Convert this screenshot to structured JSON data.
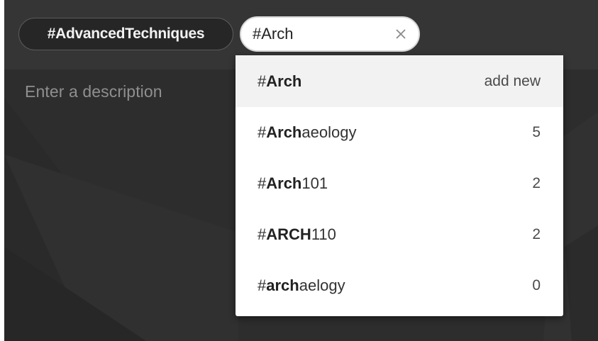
{
  "tags": {
    "existing_chip": "#AdvancedTechniques",
    "input_value": "#Arch"
  },
  "description": {
    "placeholder": "Enter a description"
  },
  "suggestions": [
    {
      "hash": "#",
      "match": "Arch",
      "rest": "",
      "right": "add new"
    },
    {
      "hash": "#",
      "match": "Arch",
      "rest": "aeology",
      "right": "5"
    },
    {
      "hash": "#",
      "match": "Arch",
      "rest": "101",
      "right": "2"
    },
    {
      "hash": "#",
      "match": "ARCH",
      "rest": "110",
      "right": "2"
    },
    {
      "hash": "#",
      "match": "arch",
      "rest": "aelogy",
      "right": "0"
    }
  ],
  "colors": {
    "background": "#2f2f2f",
    "tagbar": "#353535",
    "dropdown": "#ffffff",
    "highlight": "#f2f2f2"
  },
  "icons": {
    "clear": "close-icon"
  }
}
